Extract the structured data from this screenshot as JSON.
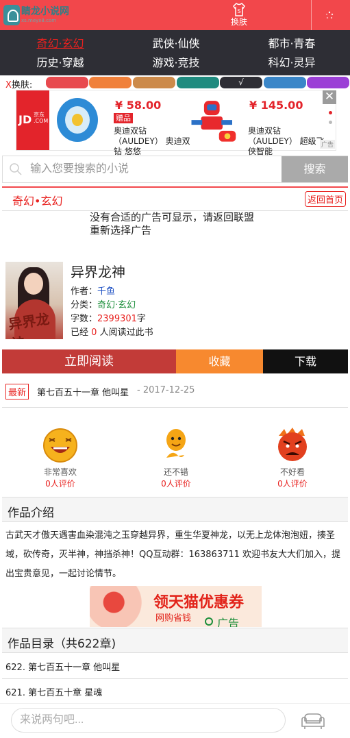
{
  "header": {
    "logo_title": "睛龙小说网",
    "logo_sub": "xs.meyx8.com",
    "skin_label": "换肤"
  },
  "categories": [
    "奇幻·玄幻",
    "武侠·仙侠",
    "都市·青春",
    "历史·穿越",
    "游戏·竞技",
    "科幻·灵异"
  ],
  "skin_bar": {
    "label_x": "X",
    "label": "换肤:",
    "swatches": [
      "#e84a4f",
      "#f0803a",
      "#cc8a4a",
      "#1f8b7f",
      "#2e2e35",
      "#3a86c8",
      "#9b3fd6"
    ],
    "selected_mark": "√"
  },
  "ad_banner": {
    "jd": "JD",
    "jd_name": "京东",
    "jd_com": ".COM",
    "price1": "¥ 58.00",
    "gift": "赠品",
    "desc1": "奥迪双钻（AULDEY） 奥迪双钻 悠悠",
    "price2": "¥ 145.00",
    "desc2": "奥迪双钻（AULDEY） 超级飞侠智能",
    "close": "✕",
    "tag": "广告"
  },
  "search": {
    "placeholder": "输入您要搜索的小说",
    "button": "搜索"
  },
  "section": {
    "title": "奇幻•玄幻",
    "back_home": "返回首页"
  },
  "no_ad_text": "没有合适的广告可显示，请返回联盟重新选择广告",
  "book": {
    "cover_text": "异界龙神",
    "title": "异界龙神",
    "author_label": "作者：",
    "author": "千鱼",
    "category_label": "分类：",
    "category": "奇幻·玄幻",
    "words_label": "字数：",
    "words": "2399301",
    "words_unit": "字",
    "read_prefix": "已经",
    "read_count": "0",
    "read_suffix": "人阅读过此书"
  },
  "actions": {
    "read": "立即阅读",
    "favorite": "收藏",
    "download": "下载"
  },
  "latest": {
    "tag": "最新",
    "chapter": "第七百五十一章 他叫星",
    "date": "- 2017-12-25"
  },
  "ratings": [
    {
      "label": "非常喜欢",
      "count": "0人评价"
    },
    {
      "label": "还不错",
      "count": "0人评价"
    },
    {
      "label": "不好看",
      "count": "0人评价"
    }
  ],
  "intro": {
    "heading": "作品介绍",
    "text": "古武天才傲天遇害血染混沌之玉穿越异界，重生华夏神龙，以无上龙体泡泡妞，揍圣域，砍传奇，灭半神，神挡杀神！QQ互动群：163863711 欢迎书友大大们加入，提出宝贵意见，一起讨论情节。"
  },
  "ad2": {
    "headline": "领天猫优惠券",
    "sub": "网购省钱",
    "label": "广告"
  },
  "toc": {
    "heading": "作品目录（共622章)",
    "items": [
      "622. 第七百五十一章 他叫星",
      "621. 第七百五十章 星魂"
    ]
  },
  "comment": {
    "placeholder": "来说两句吧..."
  }
}
